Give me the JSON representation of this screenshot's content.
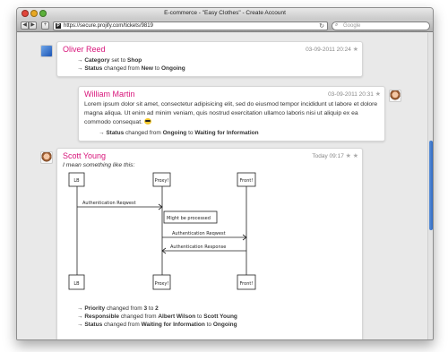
{
  "window": {
    "title": "E-commerce - \"Easy Clothes\" - Create Account"
  },
  "toolbar": {
    "back_icon": "back-arrow-icon",
    "forward_icon": "forward-arrow-icon",
    "add_label": "+",
    "url": "https://secure.projify.com/tickets/9819",
    "search_placeholder": "Google"
  },
  "comments": [
    {
      "author": "Oliver Reed",
      "time": "03-09-2011 20:24",
      "changes": [
        {
          "arrow": "→",
          "field": "Category",
          "verb": "set to",
          "to": "Shop"
        },
        {
          "arrow": "→",
          "field": "Status",
          "verb": "changed from",
          "from": "New",
          "sep": "to",
          "to": "Ongoing"
        }
      ]
    },
    {
      "author": "William Martin",
      "time": "03-09-2011 20:31",
      "text": "Lorem ipsum dolor sit amet, consectetur adipisicing elit, sed do eiusmod tempor incididunt ut labore et dolore magna aliqua. Ut enim ad minim veniam, quis nostrud exercitation ullamco laboris nisi ut aliquip ex ea commodo consequat.",
      "changes": [
        {
          "arrow": "→",
          "field": "Status",
          "verb": "changed from",
          "from": "Ongoing",
          "sep": "to",
          "to": "Waiting for Information"
        }
      ]
    },
    {
      "author": "Scott Young",
      "time": "Today 09:17",
      "text": "I mean something like this:",
      "diagram": {
        "actors": [
          "LB",
          "Proxy!",
          "Front!"
        ],
        "messages": [
          "Authentication Reqwest",
          "Might be processed",
          "Authentication Reqwest",
          "Authentication Response"
        ]
      },
      "changes": [
        {
          "arrow": "→",
          "field": "Priority",
          "verb": "changed from",
          "from": "3",
          "sep": "to",
          "to": "2"
        },
        {
          "arrow": "→",
          "field": "Responsible",
          "verb": "changed from",
          "from": "Albert Wilson",
          "sep": "to",
          "to": "Scott Young"
        },
        {
          "arrow": "→",
          "field": "Status",
          "verb": "changed from",
          "from": "Waiting for Information",
          "sep": "to",
          "to": "Ongoing"
        }
      ]
    }
  ]
}
